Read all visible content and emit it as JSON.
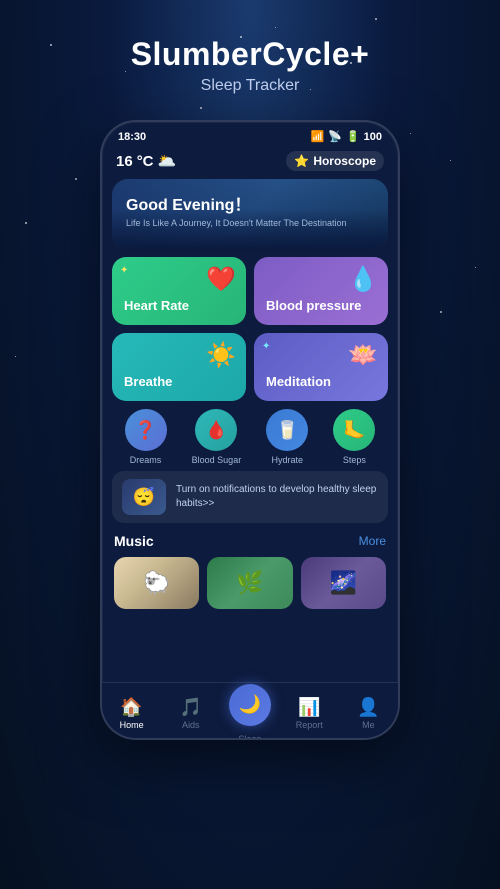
{
  "app": {
    "title": "SlumberCycle+",
    "subtitle": "Sleep Tracker"
  },
  "phone": {
    "status_bar": {
      "time": "18:30",
      "battery": "100",
      "wifi": "WiFi",
      "signal": "Signal"
    },
    "weather": {
      "temp": "16",
      "unit": "°C",
      "emoji": "🌥️"
    },
    "horoscope": {
      "label": "Horoscope"
    },
    "hero": {
      "greeting": "Good Evening！",
      "subtitle": "Life Is Like A Journey, It Doesn't Matter The Destination"
    },
    "quick_cards": [
      {
        "id": "heart-rate",
        "label": "Heart Rate",
        "icon": "❤️",
        "color_class": "card-heart"
      },
      {
        "id": "blood-pressure",
        "label": "Blood pressure",
        "icon": "💧",
        "color_class": "card-blood"
      },
      {
        "id": "breathe",
        "label": "Breathe",
        "icon": "☀️",
        "color_class": "card-breathe"
      },
      {
        "id": "meditation",
        "label": "Meditation",
        "icon": "🪷",
        "color_class": "card-meditation"
      }
    ],
    "features": [
      {
        "id": "dreams",
        "label": "Dreams",
        "icon": "❓",
        "color_class": "fc-purple"
      },
      {
        "id": "blood-sugar",
        "label": "Blood Sugar",
        "icon": "🩸",
        "color_class": "fc-teal"
      },
      {
        "id": "hydrate",
        "label": "Hydrate",
        "icon": "🥛",
        "color_class": "fc-blue"
      },
      {
        "id": "steps",
        "label": "Steps",
        "icon": "🦶",
        "color_class": "fc-green"
      }
    ],
    "notification": {
      "thumb_emoji": "😴",
      "text": "Turn on notifications to develop healthy sleep habits>>"
    },
    "music": {
      "section_title": "Music",
      "more_label": "More",
      "cards": [
        {
          "id": "sheep",
          "emoji": "🐑"
        },
        {
          "id": "nature",
          "emoji": "🌿"
        },
        {
          "id": "cosmos",
          "emoji": "🌌"
        }
      ]
    },
    "bottom_nav": [
      {
        "id": "home",
        "label": "Home",
        "icon": "🏠",
        "active": true
      },
      {
        "id": "aids",
        "label": "Aids",
        "icon": "🎵",
        "active": false
      },
      {
        "id": "sleep",
        "label": "Sleep",
        "icon": "🌙",
        "active": false,
        "is_center": true
      },
      {
        "id": "report",
        "label": "Report",
        "icon": "📊",
        "active": false
      },
      {
        "id": "me",
        "label": "Me",
        "icon": "👤",
        "active": false
      }
    ]
  }
}
